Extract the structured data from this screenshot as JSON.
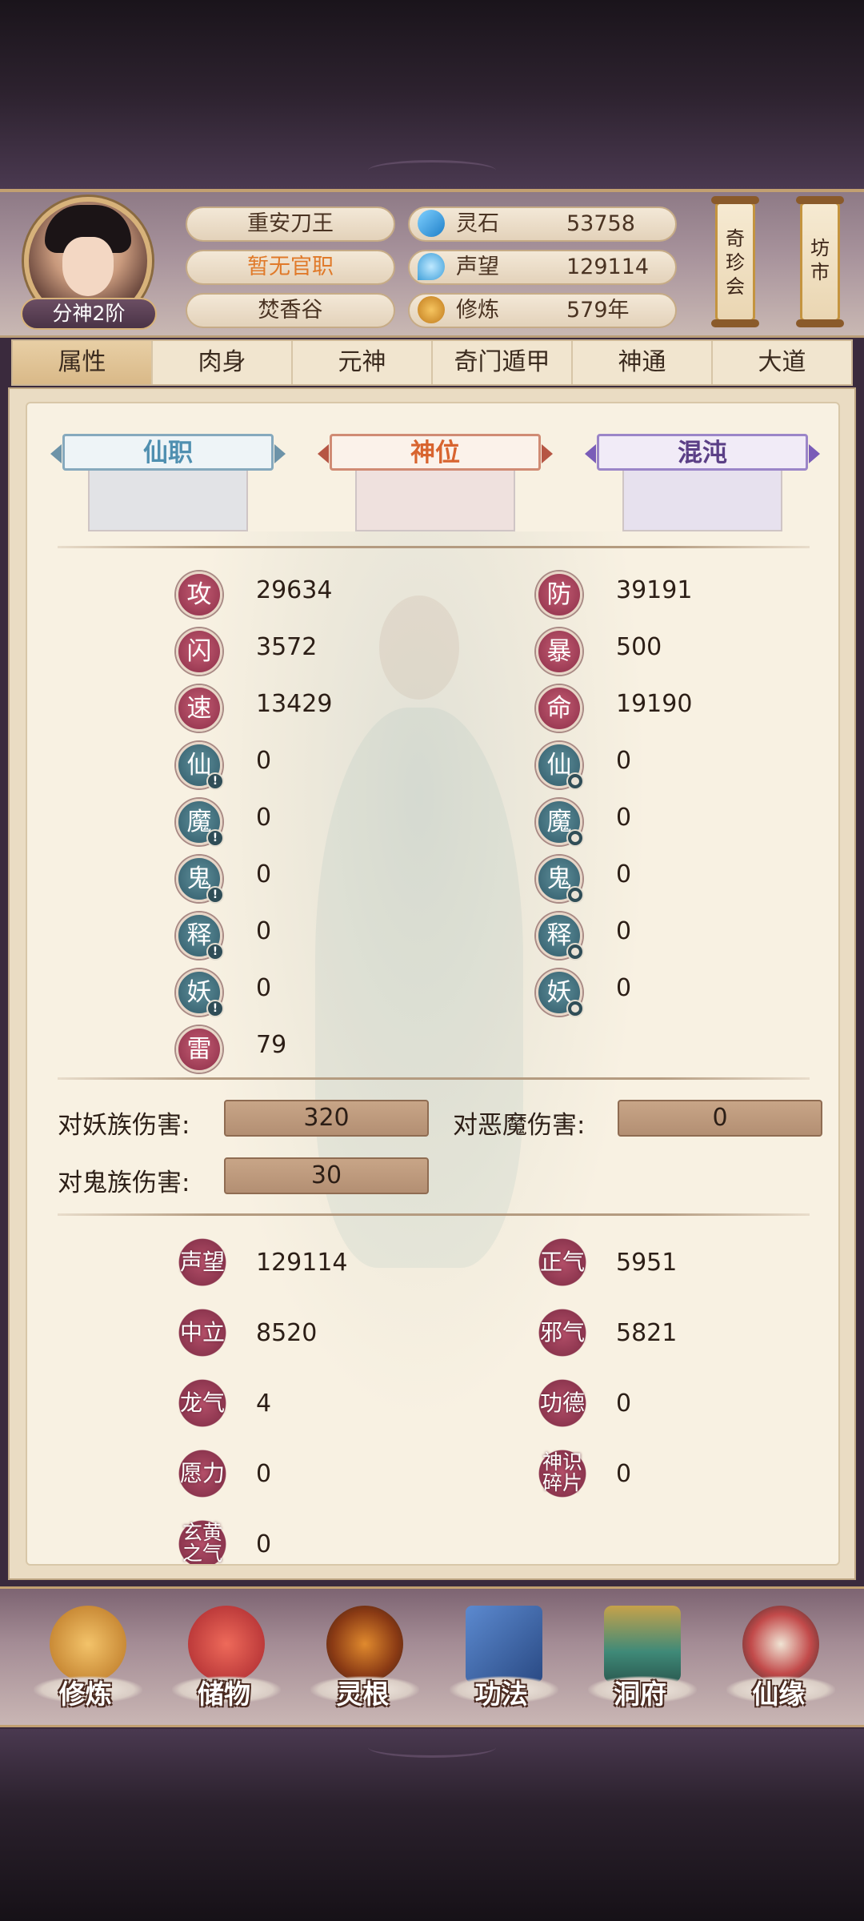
{
  "header": {
    "rank_badge": "分神2阶",
    "name": "重安刀王",
    "official_post": "暂无官职",
    "sect": "焚香谷",
    "resources": [
      {
        "icon": "spirit-stone-icon",
        "label": "灵石",
        "value": "53758",
        "color": "#3aa0e0"
      },
      {
        "icon": "reputation-icon",
        "label": "声望",
        "value": "129114",
        "color": "#5bb6e8"
      },
      {
        "icon": "cultivation-icon",
        "label": "修炼",
        "value": "579年",
        "color": "#e2a23c"
      }
    ],
    "shops": [
      {
        "label": "奇珍会"
      },
      {
        "label": "坊市"
      }
    ]
  },
  "tabs": [
    {
      "label": "属性",
      "active": true
    },
    {
      "label": "肉身"
    },
    {
      "label": "元神"
    },
    {
      "label": "奇门遁甲"
    },
    {
      "label": "神通"
    },
    {
      "label": "大道"
    }
  ],
  "rank_cards": [
    {
      "label": "仙职"
    },
    {
      "label": "神位"
    },
    {
      "label": "混沌"
    }
  ],
  "stats_left": [
    {
      "char": "攻",
      "value": "29634",
      "style": "red",
      "mark": ""
    },
    {
      "char": "闪",
      "value": "3572",
      "style": "red",
      "mark": ""
    },
    {
      "char": "速",
      "value": "13429",
      "style": "red",
      "mark": ""
    },
    {
      "char": "仙",
      "value": "0",
      "style": "teal",
      "mark": "!"
    },
    {
      "char": "魔",
      "value": "0",
      "style": "teal",
      "mark": "!"
    },
    {
      "char": "鬼",
      "value": "0",
      "style": "teal",
      "mark": "!"
    },
    {
      "char": "释",
      "value": "0",
      "style": "teal",
      "mark": "!"
    },
    {
      "char": "妖",
      "value": "0",
      "style": "teal",
      "mark": "!"
    },
    {
      "char": "雷",
      "value": "79",
      "style": "red",
      "mark": ""
    }
  ],
  "stats_right": [
    {
      "char": "防",
      "value": "39191",
      "style": "red",
      "mark": ""
    },
    {
      "char": "暴",
      "value": "500",
      "style": "red",
      "mark": ""
    },
    {
      "char": "命",
      "value": "19190",
      "style": "red",
      "mark": ""
    },
    {
      "char": "仙",
      "value": "0",
      "style": "teal",
      "mark": "o"
    },
    {
      "char": "魔",
      "value": "0",
      "style": "teal",
      "mark": "o"
    },
    {
      "char": "鬼",
      "value": "0",
      "style": "teal",
      "mark": "o"
    },
    {
      "char": "释",
      "value": "0",
      "style": "teal",
      "mark": "o"
    },
    {
      "char": "妖",
      "value": "0",
      "style": "teal",
      "mark": "o"
    }
  ],
  "damage": {
    "vs_demon_race_label": "对妖族伤害:",
    "vs_demon_race_value": "320",
    "vs_evil_demon_label": "对恶魔伤害:",
    "vs_evil_demon_value": "0",
    "vs_ghost_race_label": "对鬼族伤害:",
    "vs_ghost_race_value": "30"
  },
  "misc_left": [
    {
      "tag": "声望",
      "value": "129114",
      "style": "red"
    },
    {
      "tag": "中立",
      "value": "8520",
      "style": "red"
    },
    {
      "tag": "龙气",
      "value": "4",
      "style": "red"
    },
    {
      "tag": "愿力",
      "value": "0",
      "style": "red"
    },
    {
      "tag": "玄黄之气",
      "value": "0",
      "style": "red"
    }
  ],
  "misc_right": [
    {
      "tag": "正气",
      "value": "5951",
      "style": "red"
    },
    {
      "tag": "邪气",
      "value": "5821",
      "style": "red"
    },
    {
      "tag": "功德",
      "value": "0",
      "style": "red"
    },
    {
      "tag": "神识碎片",
      "value": "0",
      "style": "red"
    }
  ],
  "bottom_nav": [
    {
      "label": "修炼",
      "icon": "meditation-icon",
      "color": "#d9962e"
    },
    {
      "label": "储物",
      "icon": "storage-bag-icon",
      "color": "#c5353b"
    },
    {
      "label": "灵根",
      "icon": "spirit-root-icon",
      "color": "#c76a1f"
    },
    {
      "label": "功法",
      "icon": "technique-book-icon",
      "color": "#3d6aa8"
    },
    {
      "label": "洞府",
      "icon": "cave-mansion-icon",
      "color": "#3a8a7a"
    },
    {
      "label": "仙缘",
      "icon": "immortal-fate-icon",
      "color": "#c24a4a"
    }
  ]
}
